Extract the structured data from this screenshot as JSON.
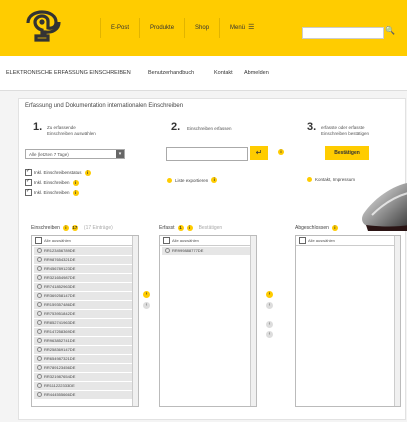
{
  "nav": {
    "items": [
      "E-Post",
      "Produkte",
      "Shop",
      "Menü"
    ],
    "search_icon": "search-icon"
  },
  "subnav": {
    "title": "ELEKTRONISCHE ERFASSUNG EINSCHREIBEN",
    "links": [
      "Benutzerhandbuch",
      "Kontakt",
      "Abmelden"
    ]
  },
  "main": {
    "heading": "Erfassung und Dokumentation internationalen Einschreiben",
    "step1": {
      "num": "1.",
      "line1": "Zu erfassende",
      "line2": "Einschreiben auswählen"
    },
    "step2": {
      "num": "2.",
      "line1": "Einschreiben erfassen"
    },
    "step3": {
      "num": "3.",
      "line1": "erfasste oder erfasste",
      "line2": "Einschreiben bestätigen"
    },
    "select_value": "Alle (letzten 7 Tage)",
    "checks": [
      "Inkl. Einschreibenstatus",
      "Inkl. Einschreiben",
      "Inkl. Einschreiben"
    ],
    "link_step2": "Liste exportieren",
    "confirm_label": "Bestätigen",
    "link_step3": "Kontakt, Impressum"
  },
  "panels": {
    "left": {
      "title": "Einschreiben",
      "count": "17",
      "sub": "(17 Einträge)",
      "select_all": "Alle auswählen"
    },
    "middle": {
      "title": "Erfasst",
      "count": "1",
      "sub": "Bestätigen",
      "select_all": "Alle auswählen"
    },
    "right": {
      "title": "Abgeschlossen",
      "select_all": "Alle auswählen"
    }
  },
  "left_rows": [
    "RR123456789DE",
    "RR987654321DE",
    "RR456789123DE",
    "RR321654987DE",
    "RR741852963DE",
    "RR369258147DE",
    "RR159357486DE",
    "RR753951842DE",
    "RR852741963DE",
    "RR147258369DE",
    "RR963852741DE",
    "RR258369147DE",
    "RR654987321DE",
    "RR789123456DE",
    "RR321987654DE",
    "RR111222333DE",
    "RR444555666DE"
  ],
  "middle_rows": [
    "RR999888777DE"
  ],
  "colors": {
    "accent": "#ffcc00",
    "panel_border": "#bbbbbb"
  }
}
